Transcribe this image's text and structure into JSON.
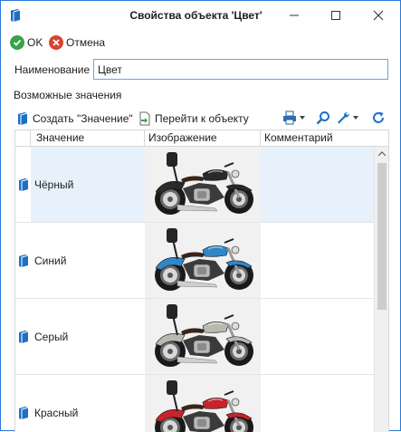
{
  "window": {
    "title": "Свойства объекта 'Цвет'",
    "minimize_label": "minimize",
    "maximize_label": "maximize",
    "close_label": "close"
  },
  "toolbar": {
    "ok_label": "OK",
    "cancel_label": "Отмена"
  },
  "form": {
    "name_label": "Наименование",
    "name_value": "Цвет",
    "values_section_label": "Возможные значения"
  },
  "list_toolbar": {
    "create_label": "Создать \"Значение\"",
    "goto_label": "Перейти к объекту",
    "icons": [
      "print-icon",
      "search-icon",
      "wrench-icon",
      "refresh-icon"
    ]
  },
  "grid": {
    "columns": [
      "Значение",
      "Изображение",
      "Комментарий"
    ],
    "rows": [
      {
        "name": "Чёрный",
        "color": "#2a2a2a",
        "comment": ""
      },
      {
        "name": "Синий",
        "color": "#2f86c8",
        "comment": ""
      },
      {
        "name": "Серый",
        "color": "#b9b9b0",
        "comment": ""
      },
      {
        "name": "Красный",
        "color": "#c8232a",
        "comment": ""
      }
    ],
    "selected_row": 0
  },
  "colors": {
    "accent": "#2b79d6",
    "ok_green": "#3aa24a",
    "cancel_red": "#d9432f",
    "selection": "#e6f1fb"
  }
}
